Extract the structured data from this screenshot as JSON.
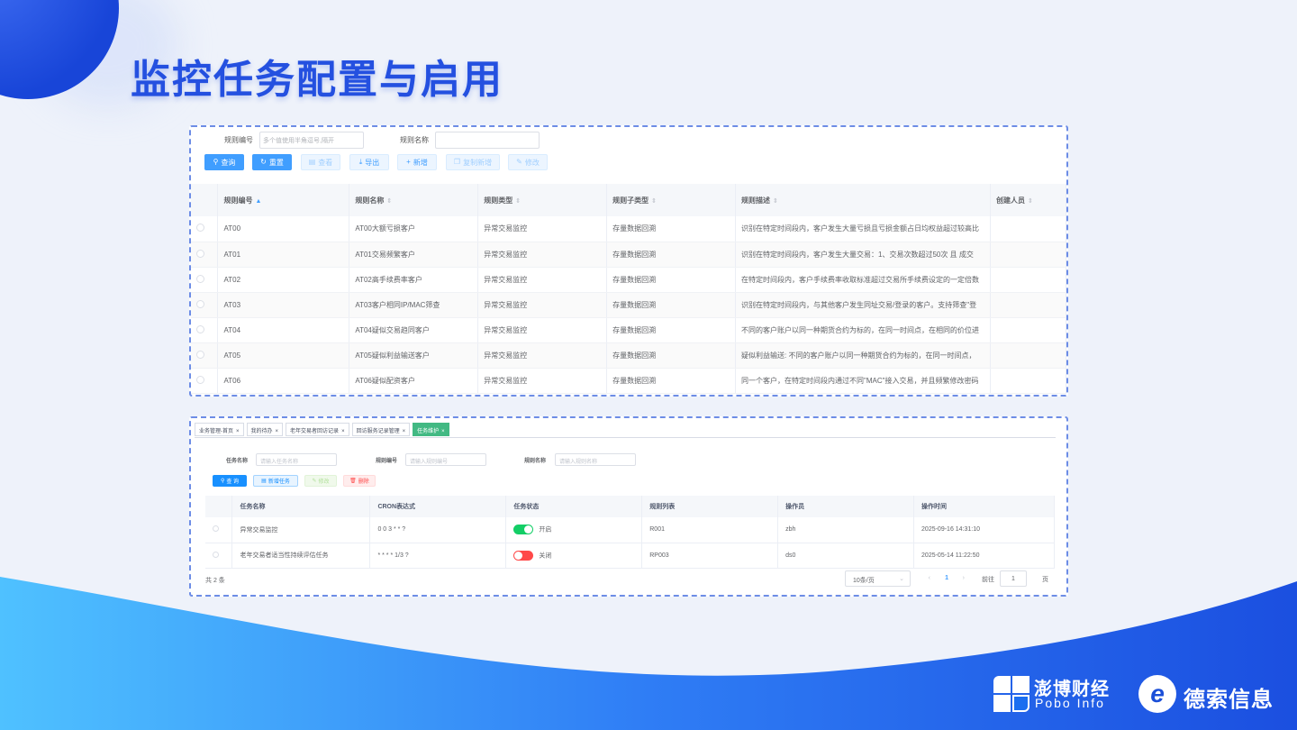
{
  "slide_title": "监控任务配置与启用",
  "panel1": {
    "filter_labels": {
      "rule_code": "规则编号",
      "rule_name": "规则名称"
    },
    "rule_code_placeholder": "多个值使用半角逗号,隔开",
    "buttons": {
      "query": "查询",
      "reset": "重置",
      "view": "查看",
      "export": "导出",
      "add": "新增",
      "copy_add": "复制新增",
      "edit": "修改"
    },
    "columns": [
      "规则编号",
      "规则名称",
      "规则类型",
      "规则子类型",
      "规则描述",
      "创建人员"
    ],
    "rows": [
      {
        "code": "AT00",
        "name": "AT00大额亏损客户",
        "type": "异常交易监控",
        "subtype": "存量数据回溯",
        "desc": "识别在特定时间段内，客户发生大量亏损且亏损金额占日均权益超过较高比"
      },
      {
        "code": "AT01",
        "name": "AT01交易频繁客户",
        "type": "异常交易监控",
        "subtype": "存量数据回溯",
        "desc": "识别在特定时间段内，客户发生大量交易：1、交易次数超过50次 且 成交"
      },
      {
        "code": "AT02",
        "name": "AT02高手续费率客户",
        "type": "异常交易监控",
        "subtype": "存量数据回溯",
        "desc": "在特定时间段内，客户手续费率收取标准超过交易所手续费设定的一定倍数"
      },
      {
        "code": "AT03",
        "name": "AT03客户相同IP/MAC筛查",
        "type": "异常交易监控",
        "subtype": "存量数据回溯",
        "desc": "识别在特定时间段内，与其他客户发生同址交易/登录的客户。支持筛查\"登"
      },
      {
        "code": "AT04",
        "name": "AT04疑似交易趋同客户",
        "type": "异常交易监控",
        "subtype": "存量数据回溯",
        "desc": "不同的客户账户以同一种期货合约为标的，在同一时间点，在相同的价位进"
      },
      {
        "code": "AT05",
        "name": "AT05疑似利益输送客户",
        "type": "异常交易监控",
        "subtype": "存量数据回溯",
        "desc": "疑似利益输送: 不同的客户账户以同一种期货合约为标的，在同一时间点，"
      },
      {
        "code": "AT06",
        "name": "AT06疑似配资客户",
        "type": "异常交易监控",
        "subtype": "存量数据回溯",
        "desc": "同一个客户，在特定时间段内通过不同\"MAC\"接入交易，并且频繁修改密码"
      }
    ]
  },
  "panel2": {
    "tabs": [
      "业务管理-首页",
      "我的待办",
      "老年交易者回访记录",
      "回访服务记录管理",
      "任务维护"
    ],
    "active_tab": 4,
    "filter_labels": {
      "task_name": "任务名称",
      "rule_code": "规则编号",
      "rule_name": "规则名称"
    },
    "placeholders": {
      "task_name": "请输入任务名称",
      "rule_code": "请输入规则编号",
      "rule_name": "请输入规则名称"
    },
    "buttons": {
      "query": "查 询",
      "add_task": "新增任务",
      "edit": "修改",
      "delete": "删除"
    },
    "columns": [
      "任务名称",
      "CRON表达式",
      "任务状态",
      "规则列表",
      "操作员",
      "操作时间"
    ],
    "rows": [
      {
        "task": "异常交易监控",
        "cron": "0 0 3 * * ?",
        "status": "开启",
        "status_on": true,
        "rules": "R001",
        "operator": "zbh",
        "time": "2025-09-16 14:31:10"
      },
      {
        "task": "老年交易者适当性持续评估任务",
        "cron": "* * * * 1/3 ?",
        "status": "关闭",
        "status_on": false,
        "rules": "RP003",
        "operator": "ds0",
        "time": "2025-05-14 11:22:50"
      }
    ],
    "total": "共 2 条",
    "page_size": "10条/页",
    "current_page": "1",
    "goto_label": "前往",
    "goto_value": "1",
    "page_unit": "页"
  },
  "logos": {
    "pobo_cn": "澎博财经",
    "pobo_en": "Pobo Info",
    "desu_cn": "德索信息"
  },
  "colors": {
    "title": "#2450e0",
    "primary": "#409eff",
    "switch_on": "#13ce66",
    "switch_off": "#ff4949",
    "dash_border": "#6d8de6"
  }
}
